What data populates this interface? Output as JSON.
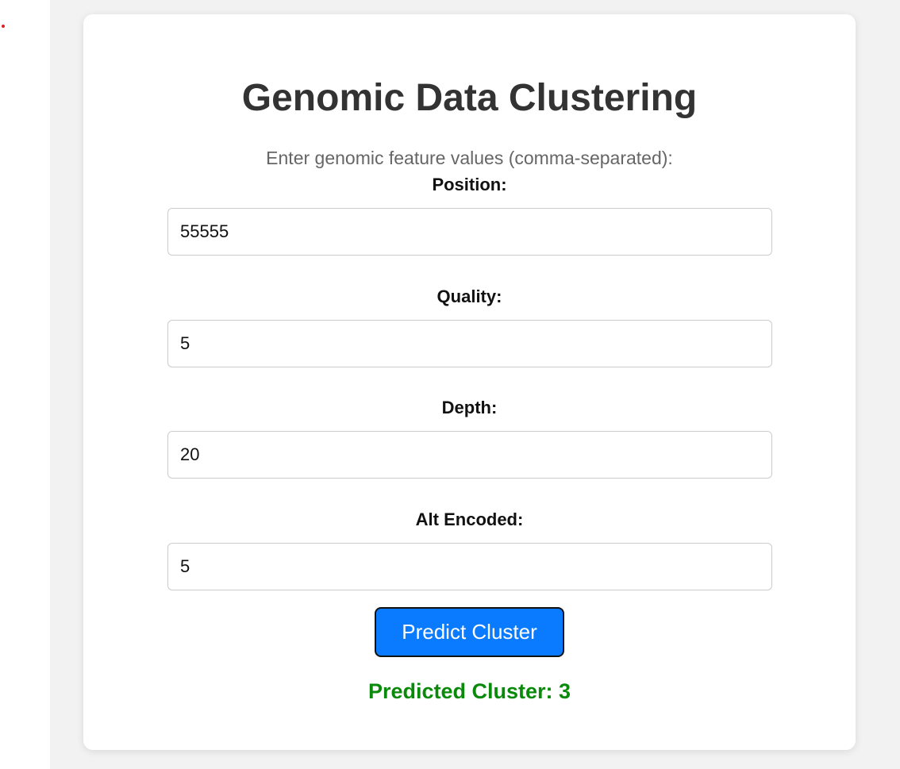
{
  "colors": {
    "page_bg": "#f2f2f2",
    "card_bg": "#ffffff",
    "title": "#333333",
    "instructions": "#666666",
    "button_bg": "#0a7bff",
    "button_text": "#ffffff",
    "result": "#0a8a0a",
    "dot": "#e02020"
  },
  "header": {
    "title": "Genomic Data Clustering",
    "instructions": "Enter genomic feature values (comma-separated):"
  },
  "form": {
    "position": {
      "label": "Position:",
      "value": "55555"
    },
    "quality": {
      "label": "Quality:",
      "value": "5"
    },
    "depth": {
      "label": "Depth:",
      "value": "20"
    },
    "alt_encoded": {
      "label": "Alt Encoded:",
      "value": "5"
    }
  },
  "actions": {
    "predict_label": "Predict Cluster"
  },
  "result": {
    "text": "Predicted Cluster: 3"
  }
}
